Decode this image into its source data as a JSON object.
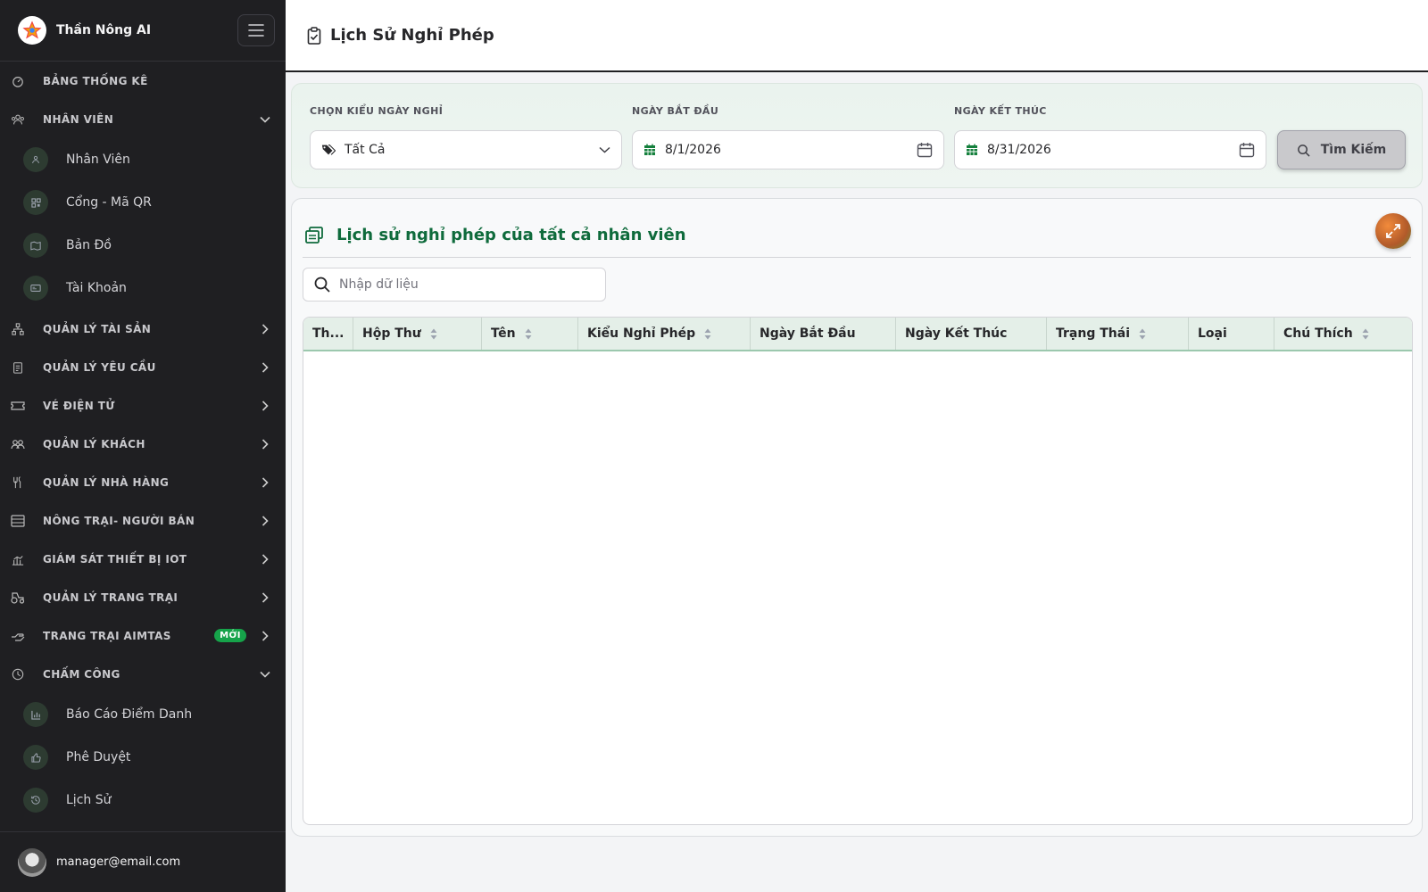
{
  "app": {
    "title": "Thần Nông AI"
  },
  "sidebar": {
    "items": [
      {
        "label": "BẢNG THỐNG KÊ",
        "icon": "gauge-icon"
      },
      {
        "label": "NHÂN VIÊN",
        "icon": "users-icon",
        "expanded": true,
        "children": [
          {
            "label": "Nhân Viên",
            "icon": "users-icon"
          },
          {
            "label": "Cổng - Mã QR",
            "icon": "qr-icon"
          },
          {
            "label": "Bản Đồ",
            "icon": "map-icon"
          },
          {
            "label": "Tài Khoản",
            "icon": "id-card-icon"
          }
        ]
      },
      {
        "label": "QUẢN LÝ TÀI SẢN",
        "icon": "sitemap-icon"
      },
      {
        "label": "QUẢN LÝ YÊU CẦU",
        "icon": "clipboard-icon"
      },
      {
        "label": "VÉ ĐIỆN TỬ",
        "icon": "ticket-icon"
      },
      {
        "label": "QUẢN LÝ KHÁCH",
        "icon": "guests-icon"
      },
      {
        "label": "QUẢN LÝ NHÀ HÀNG",
        "icon": "utensils-icon"
      },
      {
        "label": "NÔNG TRẠI- NGƯỜI BÁN",
        "icon": "store-icon"
      },
      {
        "label": "GIÁM SÁT THIẾT BỊ IOT",
        "icon": "chart-icon"
      },
      {
        "label": "QUẢN LÝ TRANG TRẠI",
        "icon": "tractor-icon"
      },
      {
        "label": "TRANG TRẠI AIMTAS",
        "icon": "hand-icon",
        "badge": "MỚI"
      },
      {
        "label": "CHẤM CÔNG",
        "icon": "clock-icon",
        "expanded": true,
        "children": [
          {
            "label": "Báo Cáo Điểm Danh",
            "icon": "bar-chart-icon"
          },
          {
            "label": "Phê Duyệt",
            "icon": "thumbs-up-icon"
          },
          {
            "label": "Lịch Sử",
            "icon": "history-icon"
          }
        ]
      }
    ]
  },
  "user": {
    "email": "manager@email.com"
  },
  "page": {
    "title": "Lịch Sử Nghỉ Phép"
  },
  "filters": {
    "leave_type_label": "CHỌN KIỂU NGÀY NGHỈ",
    "leave_type_value": "Tất Cả",
    "start_label": "NGÀY BẮT ĐẦU",
    "start_value": "8/1/2026",
    "end_label": "NGÀY KẾT THÚC",
    "end_value": "8/31/2026",
    "search_button": "Tìm Kiếm"
  },
  "table": {
    "title": "Lịch sử nghỉ phép của tất cả nhân viên",
    "search_placeholder": "Nhập dữ liệu",
    "columns": [
      {
        "label": "Th...",
        "sortable": false
      },
      {
        "label": "Hộp Thư",
        "sortable": true
      },
      {
        "label": "Tên",
        "sortable": true
      },
      {
        "label": "Kiểu Nghỉ Phép",
        "sortable": true
      },
      {
        "label": "Ngày Bắt Đầu",
        "sortable": false
      },
      {
        "label": "Ngày Kết Thúc",
        "sortable": false
      },
      {
        "label": "Trạng Thái",
        "sortable": true
      },
      {
        "label": "Loại",
        "sortable": false
      },
      {
        "label": "Chú Thích",
        "sortable": true
      }
    ],
    "rows": []
  },
  "colors": {
    "sidebar_bg": "#1f1f22",
    "accent_green": "#0f6b3c",
    "badge_green": "#16a34a"
  }
}
